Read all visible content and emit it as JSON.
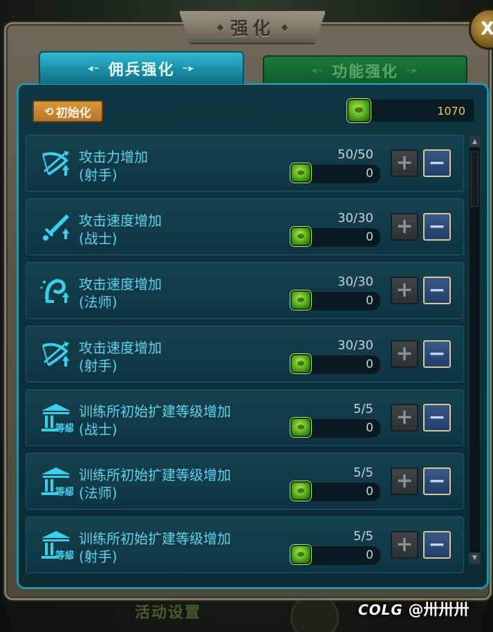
{
  "window": {
    "title": "强化",
    "close_label": "X"
  },
  "tabs": [
    {
      "label": "佣兵强化",
      "active": true
    },
    {
      "label": "功能强化",
      "active": false
    }
  ],
  "toolbar": {
    "reset_label": "初始化",
    "reset_icon": "cycle-arrows-icon",
    "currency_icon": "green-gem-icon",
    "currency_value": "1070"
  },
  "items": [
    {
      "title": "攻击力增加",
      "class": "(射手)",
      "level": "50/50",
      "cost": "0",
      "icon": "bow-icon"
    },
    {
      "title": "攻击速度增加",
      "class": "(战士)",
      "level": "30/30",
      "cost": "0",
      "icon": "sword-icon"
    },
    {
      "title": "攻击速度增加",
      "class": "(法师)",
      "level": "30/30",
      "cost": "0",
      "icon": "mage-icon"
    },
    {
      "title": "攻击速度增加",
      "class": "(射手)",
      "level": "30/30",
      "cost": "0",
      "icon": "bow-icon"
    },
    {
      "title": "训练所初始扩建等级增加",
      "class": "(战士)",
      "level": "5/5",
      "cost": "0",
      "icon": "training-hall-icon"
    },
    {
      "title": "训练所初始扩建等级增加",
      "class": "(法师)",
      "level": "5/5",
      "cost": "0",
      "icon": "training-hall-icon"
    },
    {
      "title": "训练所初始扩建等级增加",
      "class": "(射手)",
      "level": "5/5",
      "cost": "0",
      "icon": "training-hall-icon"
    }
  ],
  "buttons": {
    "plus_label": "+",
    "minus_label": "−"
  },
  "background": {
    "bottom_text": "活动设置"
  },
  "watermark": {
    "logo": "COLG",
    "handle": "@卅卅卅"
  },
  "colors": {
    "accent": "#1e97ae",
    "item_text": "#5fd2ea",
    "currency_text": "#e8c86a",
    "reset_button": "#d89a3a"
  }
}
